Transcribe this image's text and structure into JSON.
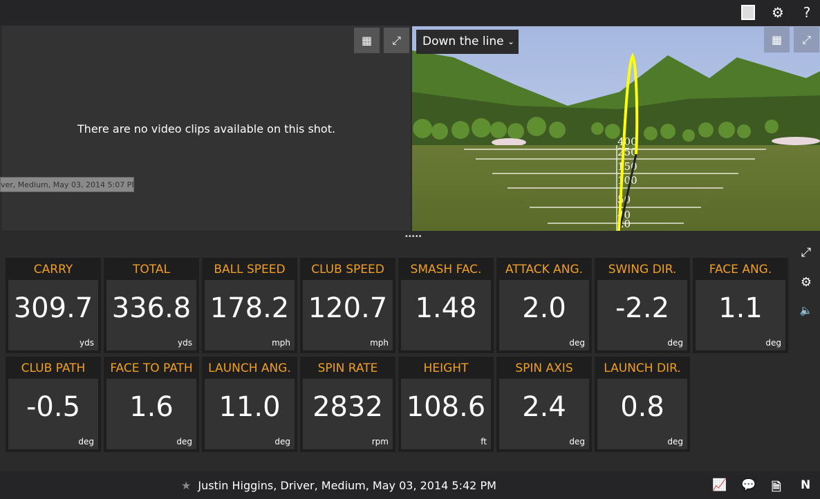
{
  "top_bar": {
    "icons": [
      "tablet-icon",
      "gear-icon",
      "help-icon"
    ],
    "help_glyph": "?"
  },
  "video_panel": {
    "message": "There are no video clips available on this shot.",
    "tooltip": "ver, Medium, May 03, 2014 5:07 PM"
  },
  "scene_panel": {
    "view_select": "Down the line",
    "distance_labels": [
      "400",
      "250",
      "150",
      "100",
      "50",
      "40",
      "20"
    ],
    "trajectory_color": "#ffff00"
  },
  "tiles": [
    {
      "label": "CARRY",
      "value": "309.7",
      "unit": "yds"
    },
    {
      "label": "TOTAL",
      "value": "336.8",
      "unit": "yds"
    },
    {
      "label": "BALL SPEED",
      "value": "178.2",
      "unit": "mph"
    },
    {
      "label": "CLUB SPEED",
      "value": "120.7",
      "unit": "mph"
    },
    {
      "label": "SMASH FAC.",
      "value": "1.48",
      "unit": ""
    },
    {
      "label": "ATTACK ANG.",
      "value": "2.0",
      "unit": "deg"
    },
    {
      "label": "SWING DIR.",
      "value": "-2.2",
      "unit": "deg"
    },
    {
      "label": "FACE ANG.",
      "value": "1.1",
      "unit": "deg"
    },
    {
      "label": "CLUB PATH",
      "value": "-0.5",
      "unit": "deg"
    },
    {
      "label": "FACE TO PATH",
      "value": "1.6",
      "unit": "deg"
    },
    {
      "label": "LAUNCH ANG.",
      "value": "11.0",
      "unit": "deg"
    },
    {
      "label": "SPIN RATE",
      "value": "2832",
      "unit": "rpm"
    },
    {
      "label": "HEIGHT",
      "value": "108.6",
      "unit": "ft"
    },
    {
      "label": "SPIN AXIS",
      "value": "2.4",
      "unit": "deg"
    },
    {
      "label": "LAUNCH DIR.",
      "value": "0.8",
      "unit": "deg"
    }
  ],
  "label_color": "#f0a020",
  "status_bar": {
    "shot": "Justin Higgins, Driver, Medium, May 03, 2014 5:42 PM",
    "n_label": "N"
  }
}
